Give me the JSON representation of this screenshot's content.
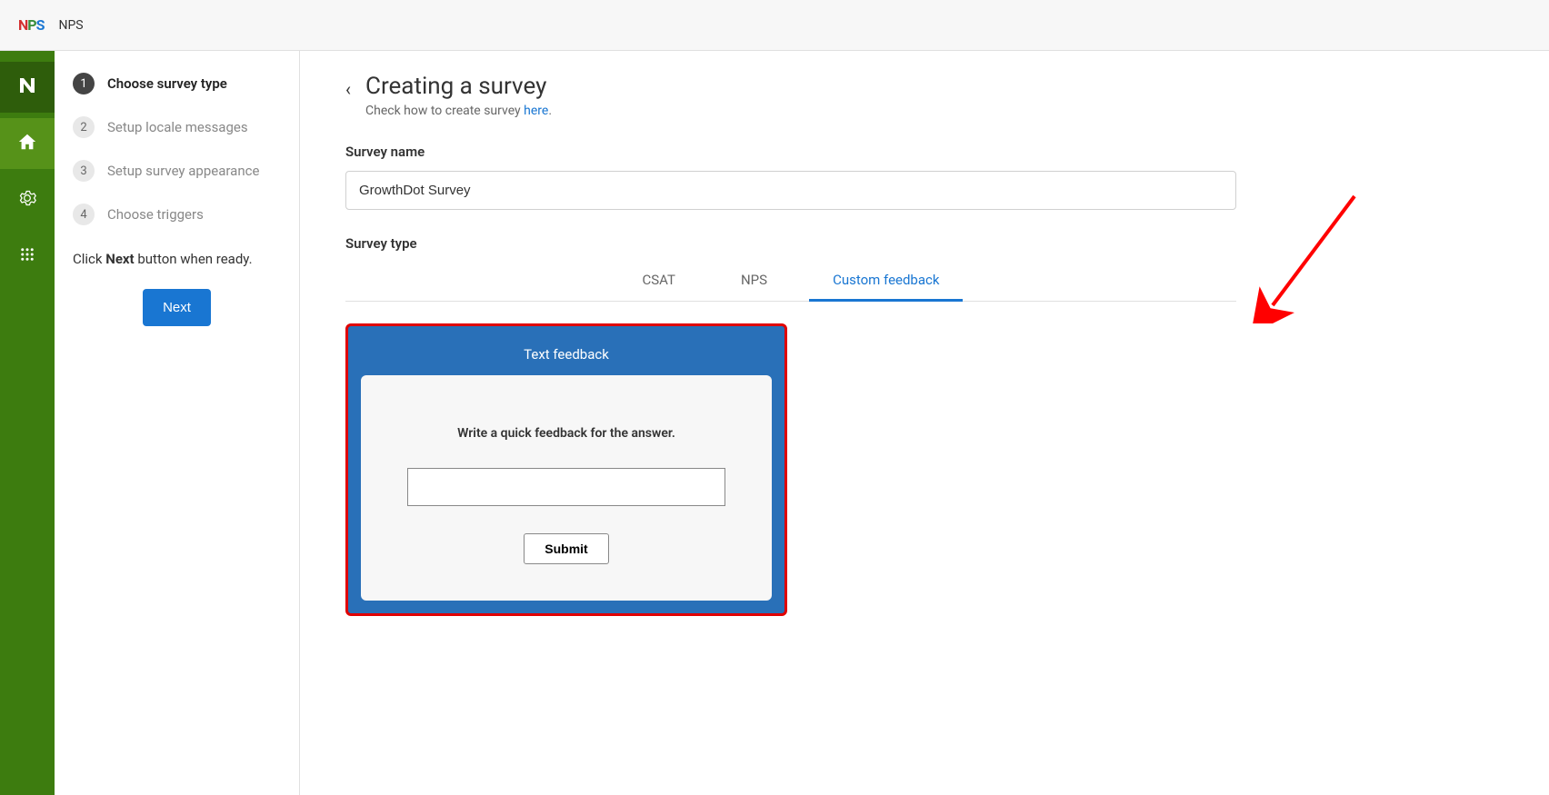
{
  "header": {
    "app_title": "NPS"
  },
  "rail": {
    "items": [
      {
        "name": "n-logo"
      },
      {
        "name": "home-icon"
      },
      {
        "name": "gear-icon"
      },
      {
        "name": "apps-icon"
      }
    ]
  },
  "sidebar": {
    "steps": [
      {
        "num": "1",
        "label": "Choose survey type",
        "active": true
      },
      {
        "num": "2",
        "label": "Setup locale messages",
        "active": false
      },
      {
        "num": "3",
        "label": "Setup survey appearance",
        "active": false
      },
      {
        "num": "4",
        "label": "Choose triggers",
        "active": false
      }
    ],
    "hint_prefix": "Click ",
    "hint_bold": "Next",
    "hint_suffix": " button when ready.",
    "next_label": "Next"
  },
  "main": {
    "title": "Creating a survey",
    "subtitle_prefix": "Check how to create survey ",
    "subtitle_link": "here",
    "subtitle_suffix": ".",
    "survey_name_label": "Survey name",
    "survey_name_value": "GrowthDot Survey",
    "survey_type_label": "Survey type",
    "tabs": [
      {
        "label": "CSAT",
        "active": false
      },
      {
        "label": "NPS",
        "active": false
      },
      {
        "label": "Custom feedback",
        "active": true
      }
    ],
    "preview": {
      "card_title": "Text feedback",
      "prompt": "Write a quick feedback for the answer.",
      "input_value": "",
      "submit_label": "Submit"
    }
  }
}
